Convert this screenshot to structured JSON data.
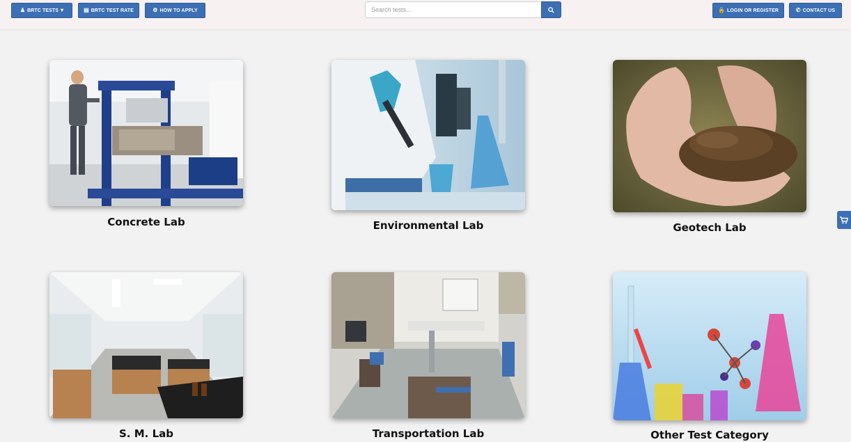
{
  "nav": {
    "tests_label": "BRTC TESTS",
    "test_rate_label": "BRTC TEST RATE",
    "how_to_apply_label": "HOW TO APPLY",
    "login_label": "LOGIN OR REGISTER",
    "contact_label": "CONTACT US"
  },
  "search": {
    "placeholder": "Search tests...",
    "value": ""
  },
  "categories": [
    {
      "label": "Concrete Lab"
    },
    {
      "label": "Environmental Lab"
    },
    {
      "label": "Geotech Lab"
    },
    {
      "label": "S. M. Lab"
    },
    {
      "label": "Transportation Lab"
    },
    {
      "label": "Other Test Category"
    }
  ],
  "icons": {
    "tests": "user-icon",
    "test_rate": "list-icon",
    "how_to_apply": "gears-icon",
    "search": "search-icon",
    "login": "lock-icon",
    "contact": "phone-icon",
    "cart": "cart-icon"
  },
  "colors": {
    "accent": "#3c6fb4",
    "background": "#f3f2f2",
    "topbar": "#f7f1f1"
  }
}
